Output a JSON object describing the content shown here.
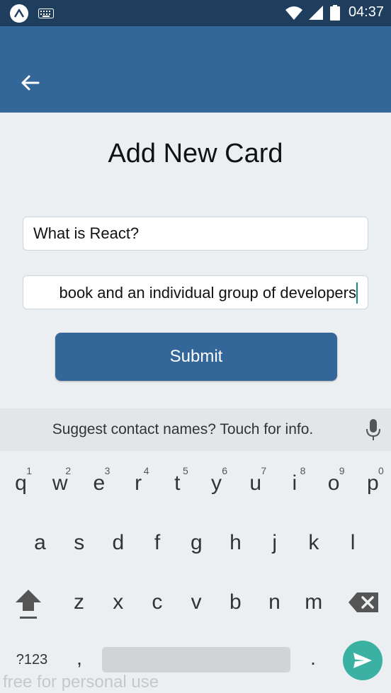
{
  "status_bar": {
    "time": "04:37"
  },
  "page": {
    "title": "Add New Card",
    "question_value": "What is React?",
    "answer_value": "book and an individual group of developers",
    "submit_label": "Submit"
  },
  "keyboard": {
    "suggestion": "Suggest contact names? Touch for info.",
    "row1": [
      {
        "key": "q",
        "hint": "1"
      },
      {
        "key": "w",
        "hint": "2"
      },
      {
        "key": "e",
        "hint": "3"
      },
      {
        "key": "r",
        "hint": "4"
      },
      {
        "key": "t",
        "hint": "5"
      },
      {
        "key": "y",
        "hint": "6"
      },
      {
        "key": "u",
        "hint": "7"
      },
      {
        "key": "i",
        "hint": "8"
      },
      {
        "key": "o",
        "hint": "9"
      },
      {
        "key": "p",
        "hint": "0"
      }
    ],
    "row2": [
      "a",
      "s",
      "d",
      "f",
      "g",
      "h",
      "j",
      "k",
      "l"
    ],
    "row3": [
      "z",
      "x",
      "c",
      "v",
      "b",
      "n",
      "m"
    ],
    "symbols_label": "?123",
    "comma": ",",
    "period": "."
  },
  "watermark": "free for personal use",
  "colors": {
    "app_bar": "#336699",
    "status_bar": "#1f3e5e",
    "accent": "#3bb1a4"
  }
}
